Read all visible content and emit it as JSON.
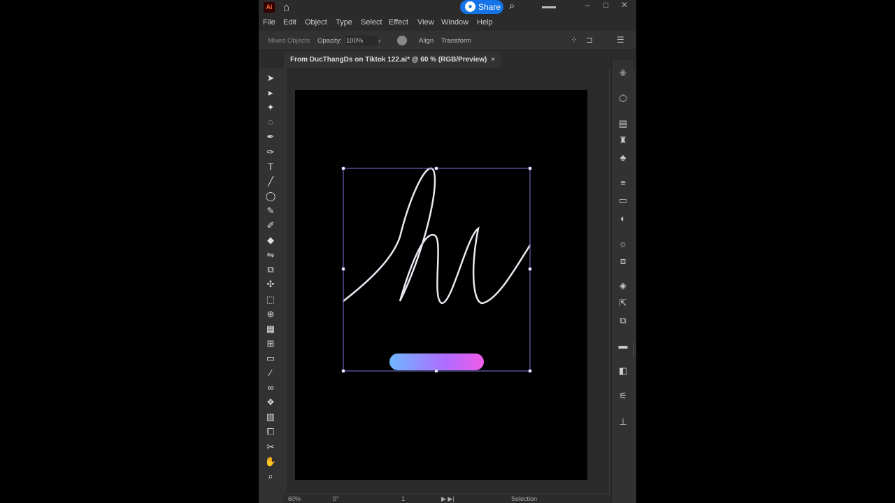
{
  "app": {
    "logo": "Ai",
    "share_label": "Share"
  },
  "menu": [
    "File",
    "Edit",
    "Object",
    "Type",
    "Select",
    "Effect",
    "View",
    "Window",
    "Help"
  ],
  "control": {
    "selection_type": "Mixed Objects",
    "opacity_label": "Opacity:",
    "opacity_value": "100%",
    "align": "Align",
    "transform": "Transform"
  },
  "document_tab": {
    "title": "From DucThangDs on Tiktok 122.ai* @ 60 % (RGB/Preview)",
    "close": "×"
  },
  "status": {
    "zoom": "60%",
    "rotation": "0°",
    "artboard": "1",
    "tool": "Selection"
  },
  "artwork": {
    "gradient_colors": [
      "#6fb7ff",
      "#b06cff",
      "#f05ce8"
    ],
    "stroke_color": "#e8e8f0",
    "selection_color": "#7a7ad8"
  },
  "tools": [
    "selection-icon",
    "direct-selection-icon",
    "magic-wand-icon",
    "lasso-icon",
    "pen-icon",
    "curvature-icon",
    "type-icon",
    "line-icon",
    "ellipse-icon",
    "paintbrush-icon",
    "shaper-icon",
    "eraser-icon",
    "reflect-icon",
    "scale-icon",
    "puppet-warp-icon",
    "free-transform-icon",
    "shape-builder-icon",
    "perspective-grid-icon",
    "mesh-icon",
    "gradient-icon",
    "eyedropper-icon",
    "blend-icon",
    "symbol-sprayer-icon",
    "graph-icon",
    "artboard-icon",
    "slice-icon",
    "hand-icon",
    "zoom-icon"
  ],
  "panels": [
    "properties-icon",
    "3d-icon",
    "libraries-icon",
    "puppet-icon",
    "symbols-icon",
    "stroke-icon",
    "gradient-icon",
    "transparency-icon",
    "appearance-icon",
    "graphic-styles-icon",
    "layers-icon",
    "export-icon",
    "artboards-icon",
    "comments-icon",
    "asset-export-icon",
    "properties-adjust-icon",
    "align-icon"
  ]
}
